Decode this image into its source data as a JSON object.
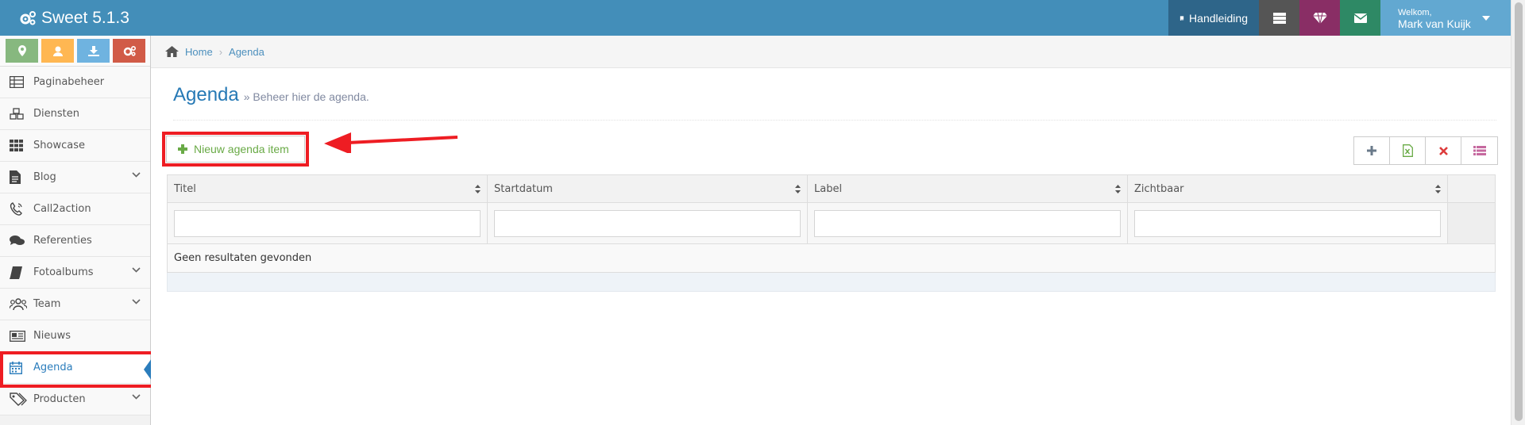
{
  "app": {
    "title": "Sweet 5.1.3"
  },
  "topbar": {
    "manual_label": "Handleiding",
    "welcome": "Welkom,",
    "user_name": "Mark van Kuijk",
    "colors": {
      "bar": "#438eb9",
      "manual": "#2e6589",
      "dark": "#555555",
      "purple": "#892e65",
      "green": "#2e8965",
      "user": "#62a8d1"
    }
  },
  "sidebar": {
    "shortcuts": [
      {
        "icon": "map-marker-icon",
        "color": "#87b87f"
      },
      {
        "icon": "user-icon",
        "color": "#ffb752"
      },
      {
        "icon": "download-icon",
        "color": "#6fb3e0"
      },
      {
        "icon": "cogs-icon",
        "color": "#d15b47"
      }
    ],
    "items": [
      {
        "label": "Paginabeheer",
        "icon": "table-icon"
      },
      {
        "label": "Diensten",
        "icon": "cubes-icon"
      },
      {
        "label": "Showcase",
        "icon": "grid-icon"
      },
      {
        "label": "Blog",
        "icon": "file-icon",
        "submenu": true
      },
      {
        "label": "Call2action",
        "icon": "phone-icon"
      },
      {
        "label": "Referenties",
        "icon": "comments-icon"
      },
      {
        "label": "Fotoalbums",
        "icon": "book-icon",
        "submenu": true
      },
      {
        "label": "Team",
        "icon": "users-icon",
        "submenu": true
      },
      {
        "label": "Nieuws",
        "icon": "newspaper-icon"
      },
      {
        "label": "Agenda",
        "icon": "calendar-icon",
        "active": true
      },
      {
        "label": "Producten",
        "icon": "tags-icon",
        "submenu": true
      }
    ]
  },
  "breadcrumb": {
    "home": "Home",
    "current": "Agenda"
  },
  "page": {
    "title": "Agenda",
    "subtitle": "» Beheer hier de agenda."
  },
  "actions": {
    "new_item": "Nieuw agenda item"
  },
  "grid": {
    "columns": [
      "Titel",
      "Startdatum",
      "Label",
      "Zichtbaar"
    ],
    "empty_message": "Geen resultaten gevonden"
  }
}
